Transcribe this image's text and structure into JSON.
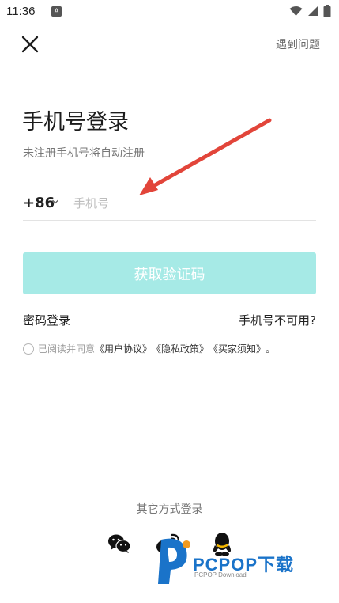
{
  "status_bar": {
    "time": "11:36",
    "indicator_letter": "A",
    "icons": [
      "wifi-icon",
      "cellular-signal-icon",
      "battery-icon"
    ]
  },
  "header": {
    "close_icon": "close-icon",
    "help_label": "遇到问题"
  },
  "login": {
    "title": "手机号登录",
    "subtitle": "未注册手机号将自动注册",
    "country_code": "+86",
    "phone_placeholder": "手机号",
    "phone_value": "",
    "get_code_label": "获取验证码",
    "password_login_label": "密码登录",
    "phone_unavailable_label": "手机号不可用?"
  },
  "agreement": {
    "prefix": "已阅读并同意",
    "user_agreement": "《用户协议》",
    "privacy_policy": "《隐私政策》",
    "buyer_notice": "《买家须知》",
    "suffix": "。"
  },
  "other_login": {
    "label": "其它方式登录",
    "methods": [
      "wechat-icon",
      "weibo-icon",
      "qq-icon"
    ]
  },
  "watermark": {
    "brand": "PCPOP下载",
    "sub": "PCPOP Download"
  },
  "colors": {
    "button_disabled": "#a6eae6",
    "annotation_arrow": "#e2453a",
    "watermark_blue": "#1a73c9"
  }
}
